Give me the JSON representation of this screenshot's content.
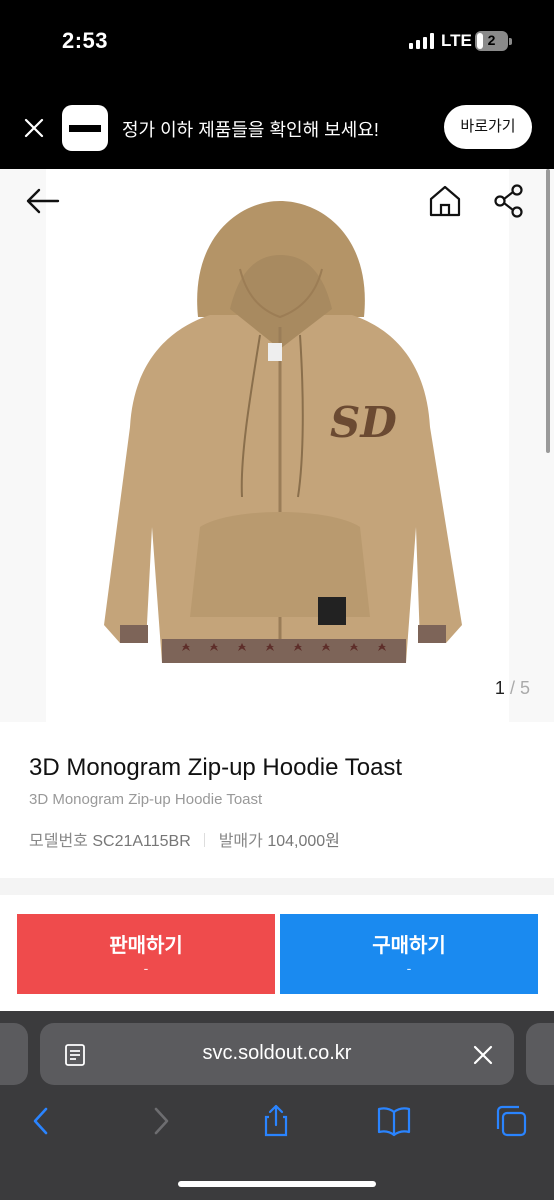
{
  "status_bar": {
    "time": "2:53",
    "network": "LTE",
    "battery": "2"
  },
  "banner": {
    "message": "정가 이하 제품들을 확인해 보세요!",
    "cta_label": "바로가기"
  },
  "gallery": {
    "current": "1",
    "separator": "/",
    "total": "5"
  },
  "product": {
    "title": "3D Monogram Zip-up Hoodie Toast",
    "subtitle": "3D Monogram Zip-up Hoodie Toast",
    "model_label": "모델번호",
    "model_value": "SC21A115BR",
    "release_label": "발매가",
    "release_value": "104,000원"
  },
  "actions": {
    "sell": {
      "label": "판매하기",
      "sub": "-",
      "color": "#ef4b4c"
    },
    "buy": {
      "label": "구매하기",
      "sub": "-",
      "color": "#1a8af0"
    }
  },
  "browser": {
    "url": "svc.soldout.co.kr"
  },
  "icons": {
    "back": "back-arrow-icon",
    "home": "home-icon",
    "share": "share-icon",
    "close": "close-icon",
    "reader": "reader-icon",
    "toolbar": [
      "chevron-left-icon",
      "chevron-right-icon",
      "share-icon",
      "book-icon",
      "tabs-icon"
    ]
  },
  "colors": {
    "browser_accent": "#2a84ff",
    "hoodie": "#c4a47a"
  }
}
